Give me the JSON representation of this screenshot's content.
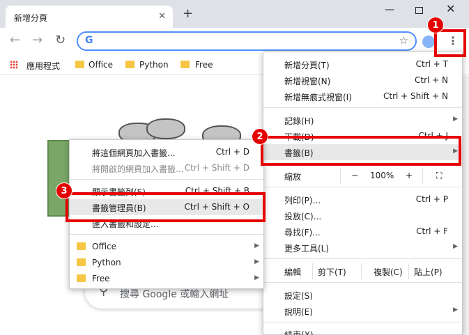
{
  "tab": {
    "title": "新增分頁",
    "close": "✕",
    "new_tab": "+"
  },
  "window": {
    "minimize": "—",
    "close": "✕"
  },
  "toolbar": {
    "back": "←",
    "forward": "→",
    "reload": "↻",
    "g": "G",
    "star": "☆",
    "kebab": "⋮"
  },
  "bookmarks_bar": {
    "apps_label": "應用程式",
    "items": [
      "Office",
      "Python",
      "Free"
    ]
  },
  "search": {
    "placeholder": "搜尋 Google 或輸入網址"
  },
  "main_menu": {
    "new_tab": {
      "label": "新增分頁(T)",
      "shortcut": "Ctrl + T"
    },
    "new_window": {
      "label": "新增視窗(N)",
      "shortcut": "Ctrl + N"
    },
    "new_incognito": {
      "label": "新增無痕式視窗(I)",
      "shortcut": "Ctrl + Shift + N"
    },
    "history": {
      "label": "記錄(H)"
    },
    "downloads": {
      "label": "下載(D)",
      "shortcut": "Ctrl + J"
    },
    "bookmarks": {
      "label": "書籤(B)"
    },
    "zoom": {
      "label": "縮放",
      "minus": "−",
      "value": "100%",
      "plus": "+"
    },
    "print": {
      "label": "列印(P)...",
      "shortcut": "Ctrl + P"
    },
    "cast": {
      "label": "投放(C)..."
    },
    "find": {
      "label": "尋找(F)...",
      "shortcut": "Ctrl + F"
    },
    "more_tools": {
      "label": "更多工具(L)"
    },
    "edit": {
      "label": "編輯",
      "cut": "剪下(T)",
      "copy": "複製(C)",
      "paste": "貼上(P)"
    },
    "settings": {
      "label": "設定(S)"
    },
    "help": {
      "label": "說明(E)"
    },
    "exit": {
      "label": "結束(X)"
    }
  },
  "sub_menu": {
    "add_page": {
      "label": "將這個網頁加入書籤...",
      "shortcut": "Ctrl + D"
    },
    "add_open": {
      "label": "將開啟的網頁加入書籤...",
      "shortcut": "Ctrl + Shift + D"
    },
    "show_bar": {
      "label": "顯示書籤列(S)",
      "shortcut": "Ctrl + Shift + B"
    },
    "manager": {
      "label": "書籤管理員(B)",
      "shortcut": "Ctrl + Shift + O"
    },
    "import": {
      "label": "匯入書籤和設定..."
    },
    "folders": [
      "Office",
      "Python",
      "Free"
    ]
  },
  "callouts": [
    "1",
    "2",
    "3"
  ],
  "colors": {
    "callout": "#e60000",
    "focus": "#4d90fe",
    "folder": "#f6c644"
  }
}
